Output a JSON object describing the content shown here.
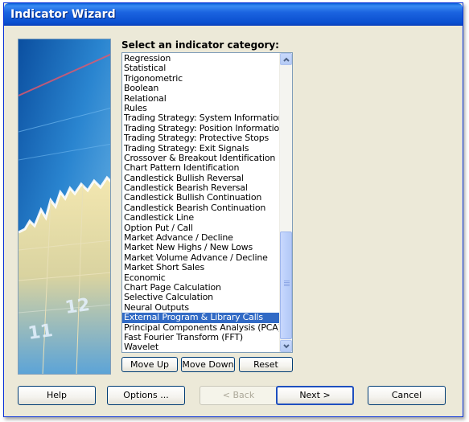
{
  "window": {
    "title": "Indicator Wizard"
  },
  "category": {
    "label": "Select an indicator category:",
    "items": [
      "Regression",
      "Statistical",
      "Trigonometric",
      "Boolean",
      "Relational",
      "Rules",
      "Trading Strategy: System Information",
      "Trading Strategy: Position Information",
      "Trading Strategy: Protective Stops",
      "Trading Strategy: Exit Signals",
      "Crossover & Breakout Identification",
      "Chart Pattern Identification",
      "Candlestick Bullish Reversal",
      "Candlestick Bearish Reversal",
      "Candlestick Bullish Continuation",
      "Candlestick Bearish Continuation",
      "Candlestick Line",
      "Option Put / Call",
      "Market Advance / Decline",
      "Market New Highs / New Lows",
      "Market Volume Advance / Decline",
      "Market Short Sales",
      "Economic",
      "Chart Page Calculation",
      "Selective Calculation",
      "Neural Outputs",
      "External Program & Library Calls",
      "Principal Components Analysis (PCA)",
      "Fast Fourier Transform (FFT)",
      "Wavelet"
    ],
    "selected_index": 26
  },
  "list_buttons": {
    "move_up": "Move Up",
    "move_down": "Move Down",
    "reset": "Reset"
  },
  "footer_buttons": {
    "help": "Help",
    "options": "Options ...",
    "back": "< Back",
    "next": "Next >",
    "cancel": "Cancel"
  },
  "decorative_image": {
    "tick_labels": [
      "11",
      "12"
    ]
  },
  "icons": {
    "scroll_up": "chevron-up-icon",
    "scroll_down": "chevron-down-icon"
  },
  "colors": {
    "titlebar": "#0a4fcf",
    "selection": "#316ac5",
    "dialog_bg": "#ece9d8"
  }
}
